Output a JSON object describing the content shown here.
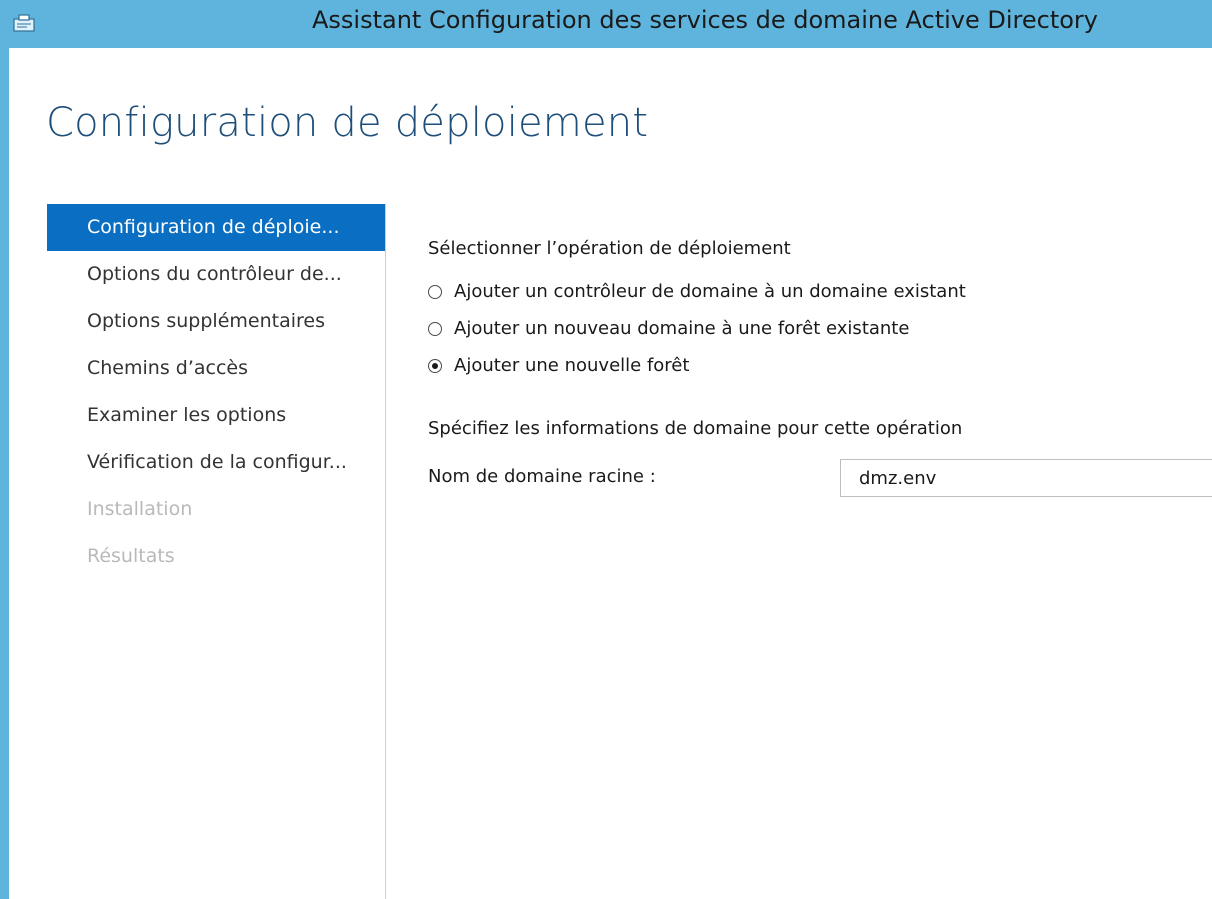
{
  "window": {
    "title": "Assistant Configuration des services de domaine Active Directory"
  },
  "page": {
    "title": "Configuration de déploiement"
  },
  "nav": {
    "items": [
      {
        "label": "Configuration de déploie...",
        "state": "active"
      },
      {
        "label": "Options du contrôleur de...",
        "state": "normal"
      },
      {
        "label": "Options supplémentaires",
        "state": "normal"
      },
      {
        "label": "Chemins d’accès",
        "state": "normal"
      },
      {
        "label": "Examiner les options",
        "state": "normal"
      },
      {
        "label": "Vérification de la configur...",
        "state": "normal"
      },
      {
        "label": "Installation",
        "state": "disabled"
      },
      {
        "label": "Résultats",
        "state": "disabled"
      }
    ]
  },
  "deployment": {
    "heading": "Sélectionner l’opération de déploiement",
    "options": [
      {
        "label": "Ajouter un contrôleur de domaine à un domaine existant",
        "checked": false
      },
      {
        "label": "Ajouter un nouveau domaine à une forêt existante",
        "checked": false
      },
      {
        "label": "Ajouter une nouvelle forêt",
        "checked": true
      }
    ]
  },
  "domain_info": {
    "heading": "Spécifiez les informations de domaine pour cette opération",
    "root_domain_label": "Nom de domaine racine :",
    "root_domain_value": "dmz.env"
  },
  "colors": {
    "titlebar": "#5fb4dd",
    "nav_active_bg": "#0a6fc2",
    "page_title": "#1e4e79",
    "nav_disabled": "#b9b9b9"
  },
  "icons": {
    "app": "server-manager-icon"
  }
}
